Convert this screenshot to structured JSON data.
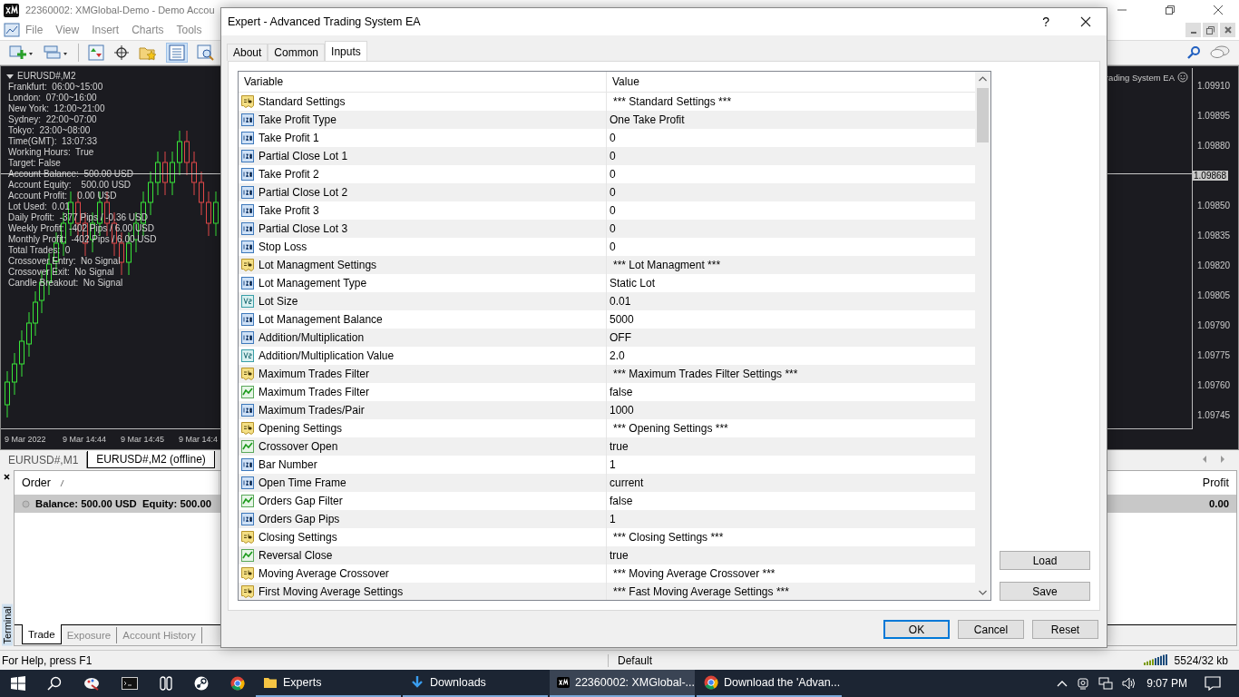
{
  "main_window": {
    "title": "22360002: XMGlobal-Demo - Demo Accou"
  },
  "menu": [
    "File",
    "View",
    "Insert",
    "Charts",
    "Tools"
  ],
  "chart": {
    "symbol": "EURUSD#,M2",
    "info_lines": [
      "Frankfurt:  06:00~15:00",
      "London:  07:00~16:00",
      "New York:  12:00~21:00",
      "Sydney:  22:00~07:00",
      "Tokyo:  23:00~08:00",
      "Time(GMT):  13:07:33",
      "Working Hours:  True",
      "Target: False",
      "Account Balance:  500.00 USD",
      "Account Equity:    500.00 USD",
      "Account Profit:    0.00 USD",
      "Lot Used:  0.01",
      "Daily Profit:  -377 Pips / -0.36 USD",
      "Weekly Profit:  -402 Pips / 6.00 USD",
      "Monthly Profit:  -402 Pips / 6.00 USD",
      "Total Trades:  0",
      "Crossover Entry:  No Signal",
      "Crossover Exit:  No Signal",
      "Candle Breakout:  No Signal"
    ],
    "expert_label": "rading System EA",
    "price_labels": [
      "1.09910",
      "1.09895",
      "1.09880",
      "1.09850",
      "1.09835",
      "1.09820",
      "1.09805",
      "1.09790",
      "1.09775",
      "1.09760",
      "1.09745"
    ],
    "current_price": "1.09868",
    "time_labels": [
      "9 Mar 2022",
      "9 Mar 14:44",
      "9 Mar 14:45",
      "9 Mar 14:4"
    ]
  },
  "chart_tabs": [
    {
      "label": "EURUSD#,M1",
      "selected": false
    },
    {
      "label": "EURUSD#,M2 (offline)",
      "selected": true
    }
  ],
  "terminal": {
    "label": "Terminal",
    "columns": [
      "Order",
      "Profit"
    ],
    "balance": "Balance: 500.00 USD  Equity: 500.00",
    "profit": "0.00",
    "tabs": [
      {
        "label": "Trade",
        "selected": true
      },
      {
        "label": "Exposure",
        "selected": false
      },
      {
        "label": "Account History",
        "selected": false
      }
    ]
  },
  "status_bar": {
    "help": "For Help, press F1",
    "profile": "Default",
    "traffic": "5524/32 kb"
  },
  "dialog": {
    "title": "Expert - Advanced Trading System EA",
    "help": "?",
    "tabs": [
      {
        "label": "About",
        "selected": false
      },
      {
        "label": "Common",
        "selected": false
      },
      {
        "label": "Inputs",
        "selected": true
      }
    ],
    "columns": [
      "Variable",
      "Value"
    ],
    "inputs": [
      {
        "kind": "string",
        "variable": "Standard Settings",
        "value": "*** Standard Settings ***"
      },
      {
        "kind": "int",
        "variable": "Take Profit Type",
        "value": "One Take Profit"
      },
      {
        "kind": "int",
        "variable": "Take Profit 1",
        "value": "0"
      },
      {
        "kind": "int",
        "variable": "Partial Close Lot 1",
        "value": "0"
      },
      {
        "kind": "int",
        "variable": "Take Profit 2",
        "value": "0"
      },
      {
        "kind": "int",
        "variable": "Partial Close Lot 2",
        "value": "0"
      },
      {
        "kind": "int",
        "variable": "Take Profit 3",
        "value": "0"
      },
      {
        "kind": "int",
        "variable": "Partial Close Lot 3",
        "value": "0"
      },
      {
        "kind": "int",
        "variable": "Stop Loss",
        "value": "0"
      },
      {
        "kind": "string",
        "variable": "Lot Managment Settings",
        "value": "*** Lot Managment ***"
      },
      {
        "kind": "int",
        "variable": "Lot Management Type",
        "value": "Static Lot"
      },
      {
        "kind": "double",
        "variable": "Lot Size",
        "value": "0.01"
      },
      {
        "kind": "int",
        "variable": "Lot Management Balance",
        "value": "5000"
      },
      {
        "kind": "int",
        "variable": "Addition/Multiplication",
        "value": "OFF"
      },
      {
        "kind": "double",
        "variable": "Addition/Multiplication Value",
        "value": "2.0"
      },
      {
        "kind": "string",
        "variable": "Maximum Trades Filter",
        "value": "*** Maximum Trades Filter Settings ***"
      },
      {
        "kind": "bool",
        "variable": "Maximum Trades Filter",
        "value": "false"
      },
      {
        "kind": "int",
        "variable": "Maximum Trades/Pair",
        "value": "1000"
      },
      {
        "kind": "string",
        "variable": "Opening Settings",
        "value": "*** Opening Settings ***"
      },
      {
        "kind": "bool",
        "variable": "Crossover Open",
        "value": "true"
      },
      {
        "kind": "int",
        "variable": "Bar Number",
        "value": "1"
      },
      {
        "kind": "int",
        "variable": "Open Time Frame",
        "value": "current"
      },
      {
        "kind": "bool",
        "variable": "Orders Gap Filter",
        "value": "false"
      },
      {
        "kind": "int",
        "variable": "Orders Gap Pips",
        "value": "1"
      },
      {
        "kind": "string",
        "variable": "Closing Settings",
        "value": "*** Closing Settings ***"
      },
      {
        "kind": "bool",
        "variable": "Reversal Close",
        "value": "true"
      },
      {
        "kind": "string",
        "variable": "Moving Average Crossover",
        "value": "*** Moving Average Crossover ***"
      },
      {
        "kind": "string",
        "variable": "First Moving Average Settings",
        "value": "*** Fast Moving Average Settings ***"
      }
    ],
    "side_buttons": [
      "Load",
      "Save"
    ],
    "buttons": [
      {
        "label": "OK",
        "default": true
      },
      {
        "label": "Cancel",
        "default": false
      },
      {
        "label": "Reset",
        "default": false
      }
    ]
  },
  "taskbar": {
    "apps": [
      {
        "kind": "folder",
        "label": "Experts",
        "selected": false
      },
      {
        "kind": "download",
        "label": "Downloads",
        "selected": false
      },
      {
        "kind": "xm",
        "label": "22360002: XMGlobal-...",
        "selected": true
      },
      {
        "kind": "browser",
        "label": "Download the 'Advan...",
        "selected": false
      }
    ],
    "time": "9:07 PM"
  }
}
